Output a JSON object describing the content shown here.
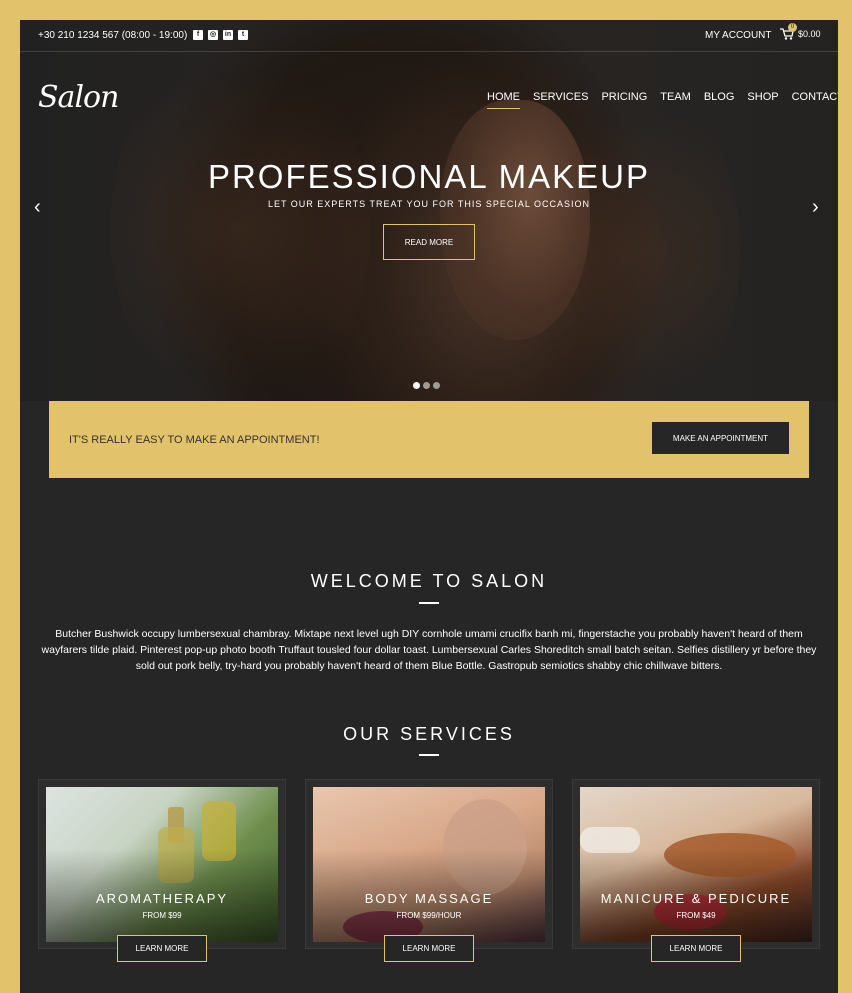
{
  "topbar": {
    "phone": "+30 210 1234 567 (08:00 - 19:00)",
    "socials": [
      {
        "icon": "facebook-icon",
        "glyph": "f"
      },
      {
        "icon": "instagram-icon",
        "glyph": "◎"
      },
      {
        "icon": "linkedin-icon",
        "glyph": "in"
      },
      {
        "icon": "twitter-icon",
        "glyph": "t"
      }
    ],
    "account": "MY ACCOUNT",
    "cart_count": "0",
    "cart_total": "$0.00"
  },
  "brand": {
    "logo": "Salon"
  },
  "nav": {
    "items": [
      "HOME",
      "SERVICES",
      "PRICING",
      "TEAM",
      "BLOG",
      "SHOP",
      "CONTACT"
    ],
    "active": "HOME"
  },
  "hero": {
    "title": "PROFESSIONAL MAKEUP",
    "subtitle": "LET OUR EXPERTS TREAT YOU FOR THIS SPECIAL OCCASION",
    "button": "READ MORE",
    "prev_icon": "‹",
    "next_icon": "›"
  },
  "appointment": {
    "text": "IT'S REALLY EASY TO MAKE AN APPOINTMENT!",
    "button": "MAKE AN APPOINTMENT"
  },
  "welcome": {
    "title": "WELCOME TO SALON",
    "text": "Butcher Bushwick occupy lumbersexual chambray. Mixtape next level ugh DIY cornhole umami crucifix banh mi, fingerstache you probably haven't heard of them wayfarers tilde plaid. Pinterest pop-up photo booth Truffaut tousled four dollar toast. Lumbersexual Carles Shoreditch small batch seitan. Selfies distillery yr before they sold out pork belly, try-hard you probably haven't heard of them Blue Bottle. Gastropub semiotics shabby chic chillwave bitters."
  },
  "services": {
    "title": "OUR SERVICES",
    "items": [
      {
        "name": "AROMATHERAPY",
        "price": "FROM $99",
        "button": "LEARN MORE"
      },
      {
        "name": "BODY MASSAGE",
        "price": "FROM $99/HOUR",
        "button": "LEARN MORE"
      },
      {
        "name": "MANICURE & PEDICURE",
        "price": "FROM $49",
        "button": "LEARN MORE"
      }
    ]
  },
  "colors": {
    "accent": "#e2c36b",
    "dark": "#262627"
  }
}
